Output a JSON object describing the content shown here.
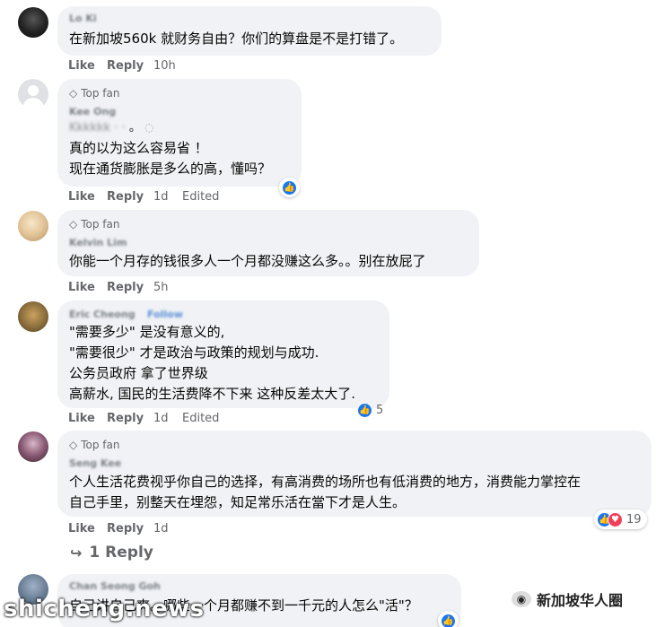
{
  "comments": [
    {
      "author": "Lo Ki",
      "top_fan": "",
      "lines": [
        "在新加坡560k 就财务自由？你们的算盘是不是打错了。"
      ],
      "like": "Like",
      "reply": "Reply",
      "time": "10h",
      "edited": ""
    },
    {
      "author": "Kee Ong",
      "top_fan": "Top fan",
      "lines": [
        "。",
        "真的以为这么容易省 ！",
        "现在通货膨胀是多么的高，懂吗？"
      ],
      "like": "Like",
      "reply": "Reply",
      "time": "1d",
      "edited": "Edited"
    },
    {
      "author": "Kelvin Lim",
      "top_fan": "Top fan",
      "lines": [
        "你能一个月存的钱很多人一个月都没赚这么多。。别在放屁了"
      ],
      "like": "Like",
      "reply": "Reply",
      "time": "5h",
      "edited": ""
    },
    {
      "author": "Eric Cheong",
      "follow": "Follow",
      "top_fan": "",
      "lines": [
        "\"需要多少\" 是没有意义的,",
        "\"需要很少\" 才是政治与政策的规划与成功.",
        "公务员政府 拿了世界级",
        "高薪水, 国民的生活费降不下来 这种反差太大了."
      ],
      "like": "Like",
      "reply": "Reply",
      "time": "1d",
      "edited": "Edited",
      "reaction_count": "5"
    },
    {
      "author": "Seng Kee",
      "top_fan": "Top fan",
      "lines": [
        "个人生活花费视乎你自己的选择，有高消费的场所也有低消费的地方，消费能力掌控在",
        "自己手里，别整天在埋怨，知足常乐活在當下才是人生。"
      ],
      "like": "Like",
      "reply": "Reply",
      "time": "1d",
      "edited": "",
      "reaction_count": "19",
      "replies_label": "1 Reply"
    },
    {
      "author": "Chan Seong Goh",
      "top_fan": "",
      "lines": [
        "自己讲自己爽。哪些一个月都赚不到一千元的人怎么\"活\"？"
      ]
    }
  ],
  "watermark": "新加坡华人圈",
  "footer_mark": "shicheng.news",
  "colors": {
    "bubble": "#f0f2f5",
    "like_blue": "#1877f2",
    "love_red": "#f33e58",
    "meta_gray": "#65676b"
  }
}
